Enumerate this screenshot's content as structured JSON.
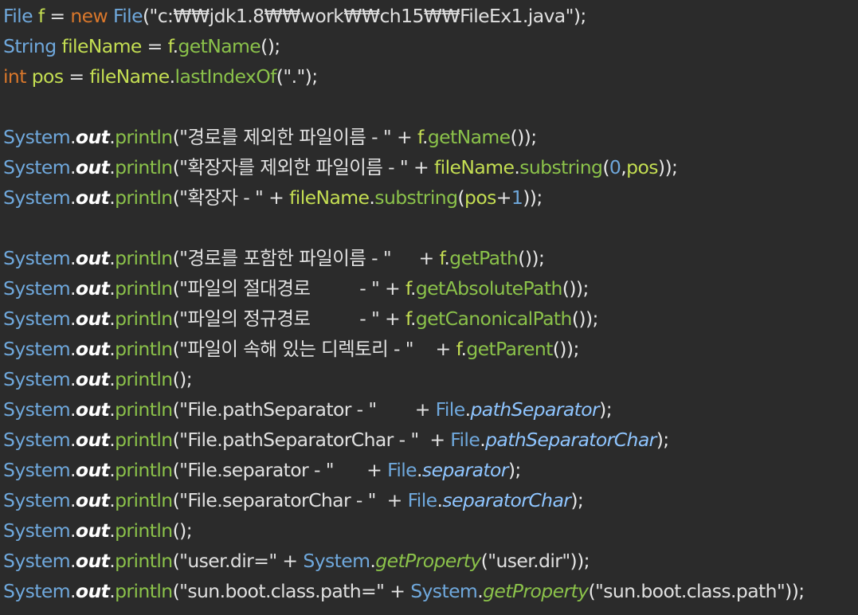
{
  "editor": {
    "lines": [
      [
        [
          "cls",
          "File"
        ],
        [
          "txt",
          " "
        ],
        [
          "var",
          "f"
        ],
        [
          "op",
          " = "
        ],
        [
          "kw",
          "new"
        ],
        [
          "txt",
          " "
        ],
        [
          "cls",
          "File"
        ],
        [
          "punc",
          "("
        ],
        [
          "str",
          "\"c:₩₩jdk1.8₩₩work₩₩ch15₩₩FileEx1.java\""
        ],
        [
          "punc",
          ");"
        ]
      ],
      [
        [
          "cls",
          "String"
        ],
        [
          "txt",
          " "
        ],
        [
          "var",
          "fileName"
        ],
        [
          "op",
          " = "
        ],
        [
          "var",
          "f"
        ],
        [
          "punc",
          "."
        ],
        [
          "meth",
          "getName"
        ],
        [
          "punc",
          "();"
        ]
      ],
      [
        [
          "kw",
          "int"
        ],
        [
          "txt",
          " "
        ],
        [
          "var",
          "pos"
        ],
        [
          "op",
          " = "
        ],
        [
          "var",
          "fileName"
        ],
        [
          "punc",
          "."
        ],
        [
          "meth",
          "lastIndexOf"
        ],
        [
          "punc",
          "("
        ],
        [
          "str",
          "\".\""
        ],
        [
          "punc",
          ");"
        ]
      ],
      [],
      [
        [
          "cls",
          "System"
        ],
        [
          "punc",
          "."
        ],
        [
          "out",
          "out"
        ],
        [
          "punc",
          "."
        ],
        [
          "meth",
          "println"
        ],
        [
          "punc",
          "("
        ],
        [
          "str",
          "\"경로를 제외한 파일이름 - \""
        ],
        [
          "op",
          " + "
        ],
        [
          "var",
          "f"
        ],
        [
          "punc",
          "."
        ],
        [
          "meth",
          "getName"
        ],
        [
          "punc",
          "());"
        ]
      ],
      [
        [
          "cls",
          "System"
        ],
        [
          "punc",
          "."
        ],
        [
          "out",
          "out"
        ],
        [
          "punc",
          "."
        ],
        [
          "meth",
          "println"
        ],
        [
          "punc",
          "("
        ],
        [
          "str",
          "\"확장자를 제외한 파일이름 - \""
        ],
        [
          "op",
          " + "
        ],
        [
          "var",
          "fileName"
        ],
        [
          "punc",
          "."
        ],
        [
          "meth",
          "substring"
        ],
        [
          "punc",
          "("
        ],
        [
          "num",
          "0"
        ],
        [
          "punc",
          ","
        ],
        [
          "var",
          "pos"
        ],
        [
          "punc",
          "));"
        ]
      ],
      [
        [
          "cls",
          "System"
        ],
        [
          "punc",
          "."
        ],
        [
          "out",
          "out"
        ],
        [
          "punc",
          "."
        ],
        [
          "meth",
          "println"
        ],
        [
          "punc",
          "("
        ],
        [
          "str",
          "\"확장자 - \""
        ],
        [
          "op",
          " + "
        ],
        [
          "var",
          "fileName"
        ],
        [
          "punc",
          "."
        ],
        [
          "meth",
          "substring"
        ],
        [
          "punc",
          "("
        ],
        [
          "var",
          "pos"
        ],
        [
          "op",
          "+"
        ],
        [
          "num",
          "1"
        ],
        [
          "punc",
          "));"
        ]
      ],
      [],
      [
        [
          "cls",
          "System"
        ],
        [
          "punc",
          "."
        ],
        [
          "out",
          "out"
        ],
        [
          "punc",
          "."
        ],
        [
          "meth",
          "println"
        ],
        [
          "punc",
          "("
        ],
        [
          "str",
          "\"경로를 포함한 파일이름 - \"     "
        ],
        [
          "op",
          "+ "
        ],
        [
          "var",
          "f"
        ],
        [
          "punc",
          "."
        ],
        [
          "meth",
          "getPath"
        ],
        [
          "punc",
          "());"
        ]
      ],
      [
        [
          "cls",
          "System"
        ],
        [
          "punc",
          "."
        ],
        [
          "out",
          "out"
        ],
        [
          "punc",
          "."
        ],
        [
          "meth",
          "println"
        ],
        [
          "punc",
          "("
        ],
        [
          "str",
          "\"파일의 절대경로         - \""
        ],
        [
          "op",
          " + "
        ],
        [
          "var",
          "f"
        ],
        [
          "punc",
          "."
        ],
        [
          "meth",
          "getAbsolutePath"
        ],
        [
          "punc",
          "());"
        ]
      ],
      [
        [
          "cls",
          "System"
        ],
        [
          "punc",
          "."
        ],
        [
          "out",
          "out"
        ],
        [
          "punc",
          "."
        ],
        [
          "meth",
          "println"
        ],
        [
          "punc",
          "("
        ],
        [
          "str",
          "\"파일의 정규경로         - \""
        ],
        [
          "op",
          " + "
        ],
        [
          "var",
          "f"
        ],
        [
          "punc",
          "."
        ],
        [
          "meth",
          "getCanonicalPath"
        ],
        [
          "punc",
          "());"
        ]
      ],
      [
        [
          "cls",
          "System"
        ],
        [
          "punc",
          "."
        ],
        [
          "out",
          "out"
        ],
        [
          "punc",
          "."
        ],
        [
          "meth",
          "println"
        ],
        [
          "punc",
          "("
        ],
        [
          "str",
          "\"파일이 속해 있는 디렉토리 - \"    "
        ],
        [
          "op",
          "+ "
        ],
        [
          "var",
          "f"
        ],
        [
          "punc",
          "."
        ],
        [
          "meth",
          "getParent"
        ],
        [
          "punc",
          "());"
        ]
      ],
      [
        [
          "cls",
          "System"
        ],
        [
          "punc",
          "."
        ],
        [
          "out",
          "out"
        ],
        [
          "punc",
          "."
        ],
        [
          "meth",
          "println"
        ],
        [
          "punc",
          "();"
        ]
      ],
      [
        [
          "cls",
          "System"
        ],
        [
          "punc",
          "."
        ],
        [
          "out",
          "out"
        ],
        [
          "punc",
          "."
        ],
        [
          "meth",
          "println"
        ],
        [
          "punc",
          "("
        ],
        [
          "str",
          "\"File.pathSeparator - \"       "
        ],
        [
          "op",
          "+ "
        ],
        [
          "cls",
          "File"
        ],
        [
          "punc",
          "."
        ],
        [
          "static",
          "pathSeparator"
        ],
        [
          "punc",
          ");"
        ]
      ],
      [
        [
          "cls",
          "System"
        ],
        [
          "punc",
          "."
        ],
        [
          "out",
          "out"
        ],
        [
          "punc",
          "."
        ],
        [
          "meth",
          "println"
        ],
        [
          "punc",
          "("
        ],
        [
          "str",
          "\"File.pathSeparatorChar - \"  "
        ],
        [
          "op",
          "+ "
        ],
        [
          "cls",
          "File"
        ],
        [
          "punc",
          "."
        ],
        [
          "static",
          "pathSeparatorChar"
        ],
        [
          "punc",
          ");"
        ]
      ],
      [
        [
          "cls",
          "System"
        ],
        [
          "punc",
          "."
        ],
        [
          "out",
          "out"
        ],
        [
          "punc",
          "."
        ],
        [
          "meth",
          "println"
        ],
        [
          "punc",
          "("
        ],
        [
          "str",
          "\"File.separator - \"      "
        ],
        [
          "op",
          "+ "
        ],
        [
          "cls",
          "File"
        ],
        [
          "punc",
          "."
        ],
        [
          "static",
          "separator"
        ],
        [
          "punc",
          ");"
        ]
      ],
      [
        [
          "cls",
          "System"
        ],
        [
          "punc",
          "."
        ],
        [
          "out",
          "out"
        ],
        [
          "punc",
          "."
        ],
        [
          "meth",
          "println"
        ],
        [
          "punc",
          "("
        ],
        [
          "str",
          "\"File.separatorChar - \"  "
        ],
        [
          "op",
          "+ "
        ],
        [
          "cls",
          "File"
        ],
        [
          "punc",
          "."
        ],
        [
          "static",
          "separatorChar"
        ],
        [
          "punc",
          ");"
        ]
      ],
      [
        [
          "cls",
          "System"
        ],
        [
          "punc",
          "."
        ],
        [
          "out",
          "out"
        ],
        [
          "punc",
          "."
        ],
        [
          "meth",
          "println"
        ],
        [
          "punc",
          "();"
        ]
      ],
      [
        [
          "cls",
          "System"
        ],
        [
          "punc",
          "."
        ],
        [
          "out",
          "out"
        ],
        [
          "punc",
          "."
        ],
        [
          "meth",
          "println"
        ],
        [
          "punc",
          "("
        ],
        [
          "str",
          "\"user.dir=\""
        ],
        [
          "op",
          " + "
        ],
        [
          "cls",
          "System"
        ],
        [
          "punc",
          "."
        ],
        [
          "imeth",
          "getProperty"
        ],
        [
          "punc",
          "("
        ],
        [
          "str",
          "\"user.dir\""
        ],
        [
          "punc",
          "));"
        ]
      ],
      [
        [
          "cls",
          "System"
        ],
        [
          "punc",
          "."
        ],
        [
          "out",
          "out"
        ],
        [
          "punc",
          "."
        ],
        [
          "meth",
          "println"
        ],
        [
          "punc",
          "("
        ],
        [
          "str",
          "\"sun.boot.class.path=\""
        ],
        [
          "op",
          " + "
        ],
        [
          "cls",
          "System"
        ],
        [
          "punc",
          "."
        ],
        [
          "imeth",
          "getProperty"
        ],
        [
          "punc",
          "("
        ],
        [
          "str",
          "\"sun.boot.class.path\""
        ],
        [
          "punc",
          "));"
        ]
      ]
    ]
  },
  "colors": {
    "background": "#2b2b2b",
    "class": "#6fa8dc",
    "variable": "#c4de52",
    "keyword": "#d9772b",
    "method": "#8bc24a",
    "string": "#e0e0e0",
    "static_field": "#8fc5ff"
  }
}
